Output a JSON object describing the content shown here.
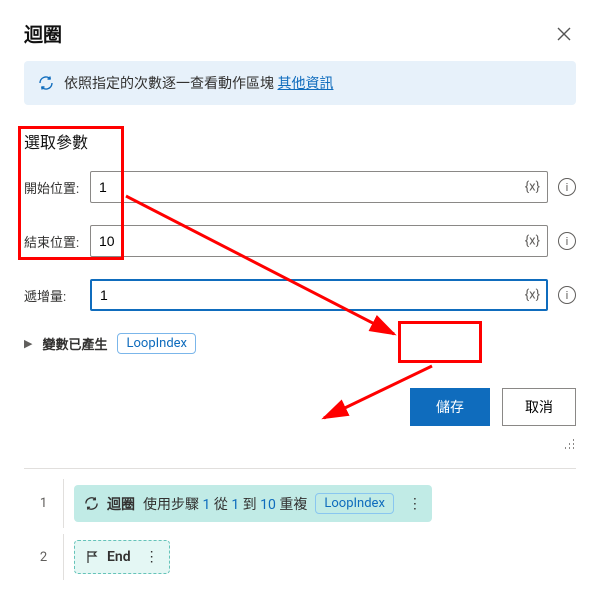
{
  "dialog": {
    "title": "迴圈",
    "info_text": "依照指定的次數逐一查看動作區塊 ",
    "info_link": "其他資訊",
    "section": "選取參數",
    "params": {
      "start_label": "開始位置:",
      "start_value": "1",
      "end_label": "結束位置:",
      "end_value": "10",
      "incr_label": "遞增量:",
      "incr_value": "1",
      "var_token": "{x}"
    },
    "generated": {
      "label": "變數已產生",
      "chip": "LoopIndex"
    },
    "buttons": {
      "save": "儲存",
      "cancel": "取消"
    }
  },
  "steps": {
    "row1": {
      "num": "1",
      "name": "迴圈",
      "prefix": "使用步驟 ",
      "step_val": "1",
      "mid1": " 從 ",
      "from_val": "1",
      "mid2": " 到 ",
      "to_val": "10",
      "suffix": " 重複",
      "var": "LoopIndex"
    },
    "row2": {
      "num": "2",
      "end": "End"
    }
  }
}
